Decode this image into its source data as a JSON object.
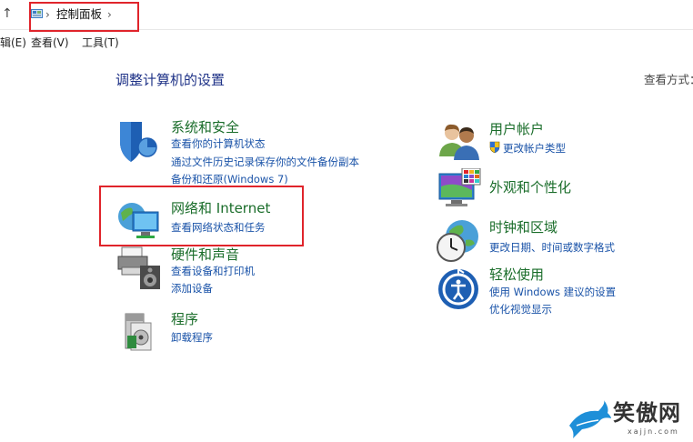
{
  "address_bar": {
    "breadcrumb": "控制面板",
    "separator": "›"
  },
  "menubar": {
    "items": [
      "辑(E)",
      "查看(V)",
      "工具(T)"
    ]
  },
  "main": {
    "title": "调整计算机的设置",
    "view_by": "查看方式："
  },
  "categories": {
    "security": {
      "title": "系统和安全",
      "links": [
        "查看你的计算机状态",
        "通过文件历史记录保存你的文件备份副本",
        "备份和还原(Windows 7)"
      ]
    },
    "network": {
      "title": "网络和 Internet",
      "links": [
        "查看网络状态和任务"
      ]
    },
    "hardware": {
      "title": "硬件和声音",
      "links": [
        "查看设备和打印机",
        "添加设备"
      ]
    },
    "programs": {
      "title": "程序",
      "links": [
        "卸载程序"
      ]
    },
    "accounts": {
      "title": "用户帐户",
      "links": [
        "更改帐户类型"
      ]
    },
    "appearance": {
      "title": "外观和个性化",
      "links": []
    },
    "clock": {
      "title": "时钟和区域",
      "links": [
        "更改日期、时间或数字格式"
      ]
    },
    "ease": {
      "title": "轻松使用",
      "links": [
        "使用 Windows 建议的设置",
        "优化视觉显示"
      ]
    }
  },
  "watermark": {
    "text": "笑傲网",
    "sub": "xajjn.com"
  },
  "colors": {
    "title_blue": "#1e3287",
    "category_green": "#1a6d2a",
    "link_blue": "#1a53a8",
    "highlight_red": "#e0242b"
  }
}
